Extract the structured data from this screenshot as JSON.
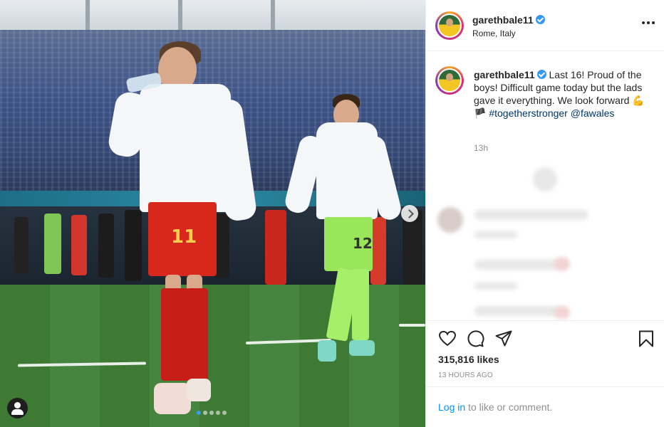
{
  "post": {
    "username": "garethbale11",
    "location": "Rome, Italy",
    "caption_text": "Last 16! Proud of the boys! Difficult game today but the lads gave it everything. We look forward",
    "caption_emoji": "💪🏴",
    "hashtag": "#togetherstronger",
    "mention": "@fawales",
    "relative_time": "13h",
    "likes": "315,816 likes",
    "timestamp": "13 HOURS AGO"
  },
  "photo": {
    "player1_number": "11",
    "player2_number": "12",
    "carousel": {
      "total": 5,
      "active": 1
    }
  },
  "footer": {
    "login_link": "Log in",
    "login_rest": " to like or comment."
  },
  "colors": {
    "link": "#00376b",
    "login_link": "#0095f6",
    "verified": "#3897f0"
  },
  "icons": [
    "more-options-icon",
    "heart-icon",
    "comment-icon",
    "share-icon",
    "bookmark-icon",
    "verified-icon",
    "user-tag-icon",
    "next-arrow-icon"
  ]
}
